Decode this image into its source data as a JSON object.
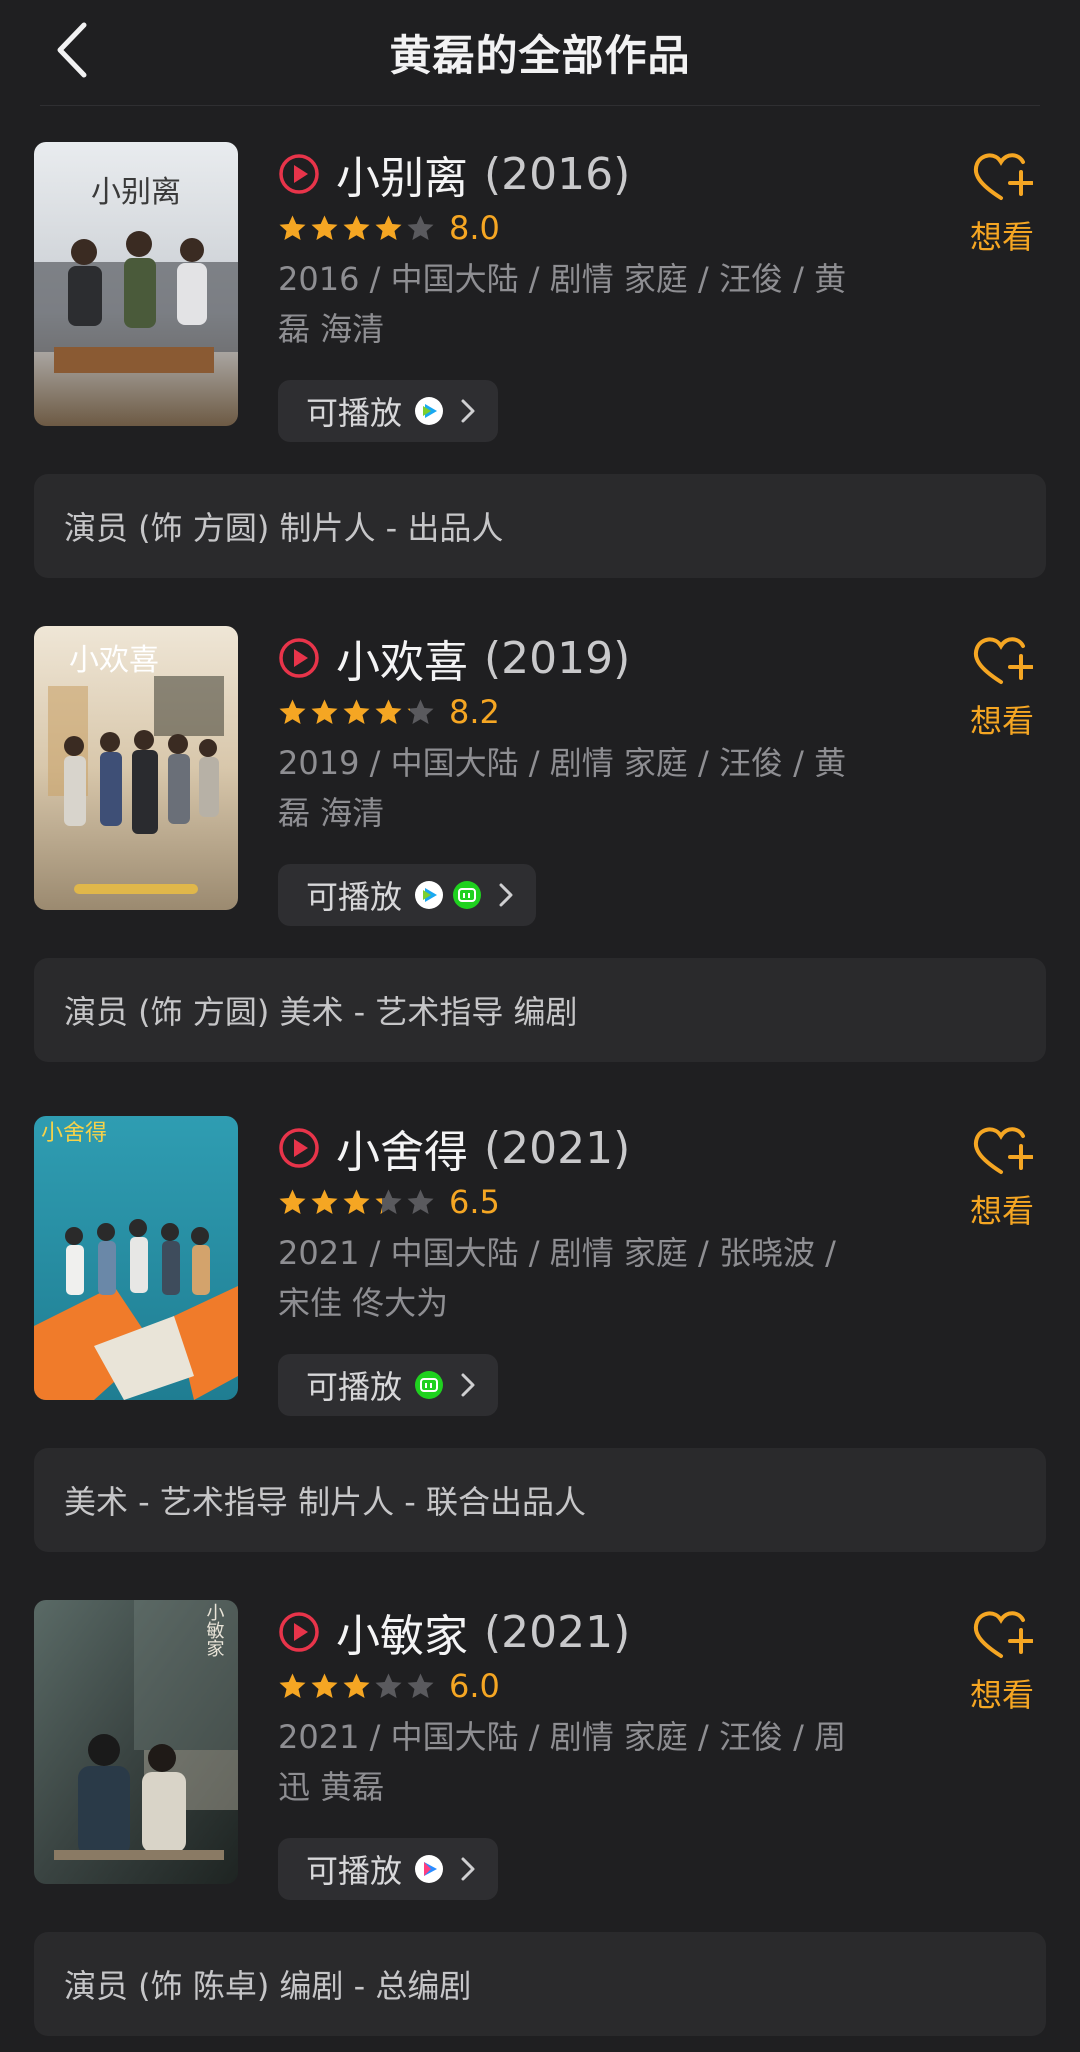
{
  "header": {
    "title": "黄磊的全部作品",
    "back_icon": "chevron-left-icon"
  },
  "colors": {
    "background": "#1f1f21",
    "accent_orange": "#f5a623",
    "play_red": "#e8344a",
    "card": "#2a2a2c"
  },
  "items": [
    {
      "title": "小别离",
      "year": "(2016)",
      "rating": 8.0,
      "rating_text": "8.0",
      "meta": "2016 / 中国大陆 / 剧情 家庭 / 汪俊 / 黄磊 海清",
      "play_label": "可播放",
      "platforms": [
        "tencent-video-icon"
      ],
      "want_label": "想看",
      "roles": "演员 (饰 方圆) 制片人 - 出品人",
      "poster_text": "小别离"
    },
    {
      "title": "小欢喜",
      "year": "(2019)",
      "rating": 8.2,
      "rating_text": "8.2",
      "meta": "2019 / 中国大陆 / 剧情 家庭 / 汪俊 / 黄磊 海清",
      "play_label": "可播放",
      "platforms": [
        "tencent-video-icon",
        "iqiyi-icon"
      ],
      "want_label": "想看",
      "roles": "演员 (饰 方圆) 美术 - 艺术指导 编剧",
      "poster_text": "小欢喜"
    },
    {
      "title": "小舍得",
      "year": "(2021)",
      "rating": 6.5,
      "rating_text": "6.5",
      "meta": "2021 / 中国大陆 / 剧情 家庭 / 张晓波 / 宋佳 佟大为",
      "play_label": "可播放",
      "platforms": [
        "iqiyi-icon"
      ],
      "want_label": "想看",
      "roles": "美术 - 艺术指导 制片人 - 联合出品人",
      "poster_text": "小舍得"
    },
    {
      "title": "小敏家",
      "year": "(2021)",
      "rating": 6.0,
      "rating_text": "6.0",
      "meta": "2021 / 中国大陆 / 剧情 家庭 / 汪俊 / 周迅 黄磊",
      "play_label": "可播放",
      "platforms": [
        "youku-icon"
      ],
      "want_label": "想看",
      "roles": "演员 (饰 陈卓) 编剧 - 总编剧",
      "poster_text": "小敏家"
    }
  ]
}
